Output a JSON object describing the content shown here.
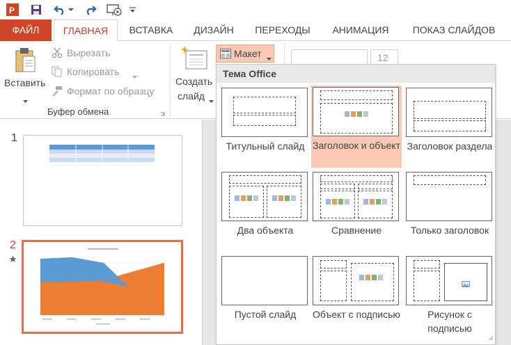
{
  "tabs": {
    "file": "ФАЙЛ",
    "home": "ГЛАВНАЯ",
    "insert": "ВСТАВКА",
    "design": "ДИЗАЙН",
    "transitions": "ПЕРЕХОДЫ",
    "animations": "АНИМАЦИЯ",
    "slideshow": "ПОКАЗ СЛАЙДОВ"
  },
  "ribbon": {
    "paste": "Вставить",
    "cut": "Вырезать",
    "copy": "Копировать",
    "format_painter": "Формат по образцу",
    "clipboard_group": "Буфер обмена",
    "new_slide_line1": "Создать",
    "new_slide_line2": "слайд",
    "layout_button": "Макет",
    "font_size": "12"
  },
  "layout_menu": {
    "header": "Тема Office",
    "items": [
      {
        "label": "Титульный слайд"
      },
      {
        "label": "Заголовок и объект"
      },
      {
        "label": "Заголовок раздела"
      },
      {
        "label": "Два объекта"
      },
      {
        "label": "Сравнение"
      },
      {
        "label": "Только заголовок"
      },
      {
        "label": "Пустой слайд"
      },
      {
        "label": "Объект с подписью"
      },
      {
        "label": "Рисунок с подписью"
      }
    ]
  },
  "slides": [
    {
      "number": "1"
    },
    {
      "number": "2"
    }
  ],
  "colors": {
    "accent": "#c43e1c",
    "file_tab": "#d04525",
    "hover": "#f9c9b3",
    "selected_border": "#e56f4a"
  }
}
